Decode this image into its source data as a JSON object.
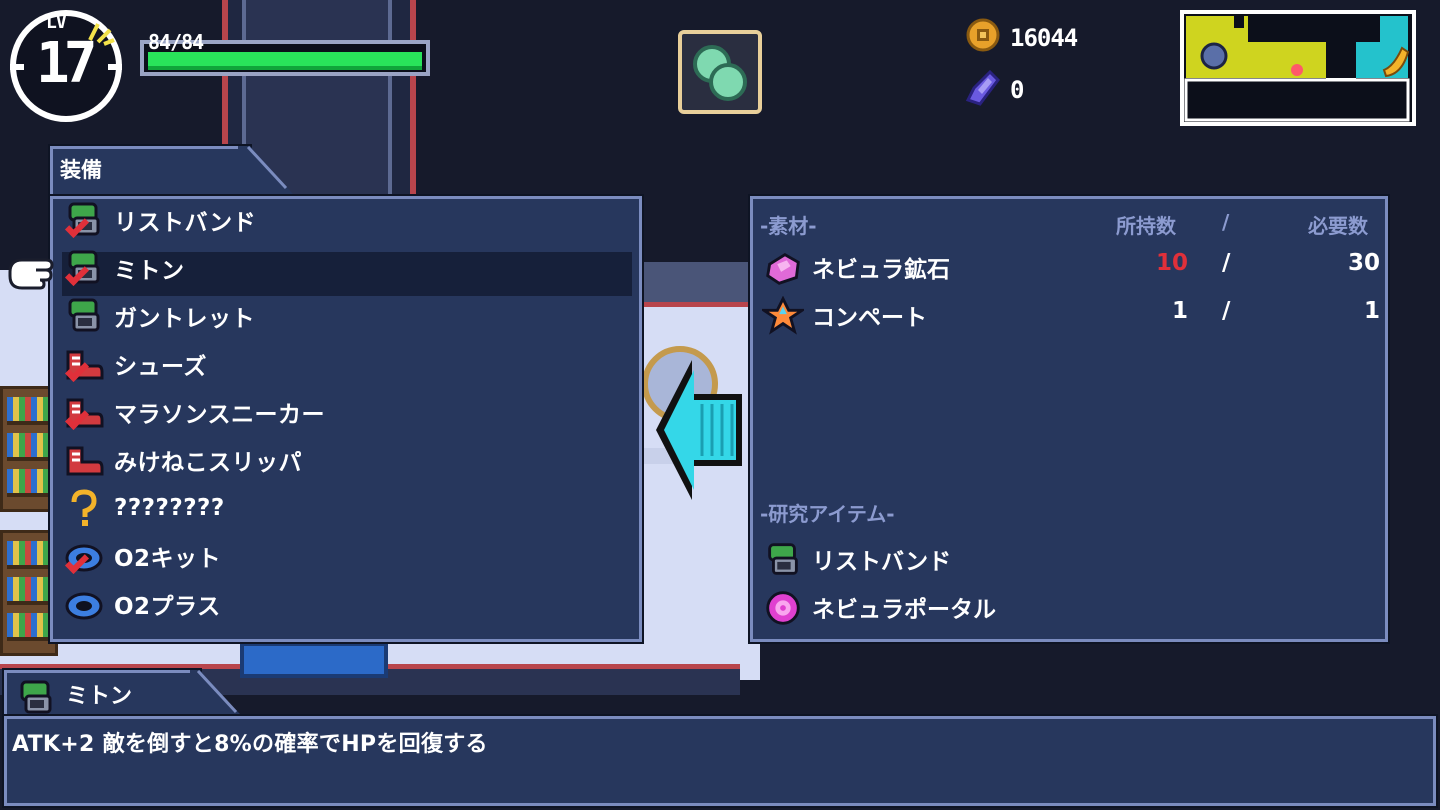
{
  "hud": {
    "level_label": "LV",
    "level": "17",
    "hp_text": "84/84",
    "hp_fraction": 1.0,
    "coins": "16044",
    "gems": "0"
  },
  "equipment": {
    "title": "装備",
    "selected_index": 1,
    "items": [
      {
        "label": "リストバンド",
        "icon": "wristband-icon",
        "checked": true
      },
      {
        "label": "ミトン",
        "icon": "mitten-icon",
        "checked": true
      },
      {
        "label": "ガントレット",
        "icon": "gauntlet-icon",
        "checked": false
      },
      {
        "label": "シューズ",
        "icon": "shoes-icon",
        "checked": true
      },
      {
        "label": "マラソンスニーカー",
        "icon": "sneaker-icon",
        "checked": true
      },
      {
        "label": "みけねこスリッパ",
        "icon": "slipper-icon",
        "checked": false
      },
      {
        "label": "????????",
        "icon": "question-icon",
        "checked": false
      },
      {
        "label": "O2キット",
        "icon": "o2-kit-icon",
        "checked": true
      },
      {
        "label": "O2プラス",
        "icon": "o2-plus-icon",
        "checked": false
      }
    ]
  },
  "materials": {
    "header": "-素材-",
    "col_owned": "所持数",
    "col_slash": "/",
    "col_required": "必要数",
    "rows": [
      {
        "name": "ネビュラ鉱石",
        "owned": "10",
        "slash": "/",
        "required": "30",
        "icon": "nebula-ore-icon",
        "insufficient": true
      },
      {
        "name": "コンペート",
        "owned": "1",
        "slash": "/",
        "required": "1",
        "icon": "konpeito-icon",
        "insufficient": false
      }
    ],
    "research_header": "-研究アイテム-",
    "research_items": [
      {
        "name": "リストバンド",
        "icon": "wristband-icon"
      },
      {
        "name": "ネビュラポータル",
        "icon": "nebula-portal-icon"
      }
    ]
  },
  "description": {
    "name": "ミトン",
    "text": "ATK+2 敵を倒すと8%の確率でHPを回復する"
  },
  "colors": {
    "panel": "#27375d",
    "panel_border": "#7b8cbf",
    "hp_green": "#29e35a",
    "insufficient_red": "#e0303a",
    "header_blue": "#8c9bd0"
  }
}
